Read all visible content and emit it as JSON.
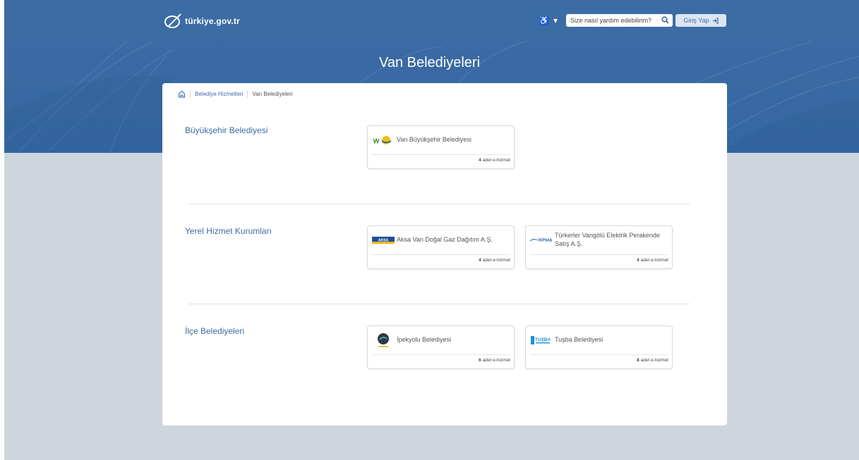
{
  "header": {
    "logo_text": "türkiye.gov.tr",
    "accessibility_label": "♿",
    "search_placeholder": "Size nasıl yardım edebilirim?",
    "login_label": "Giriş Yap"
  },
  "page": {
    "title": "Van Belediyeleri"
  },
  "breadcrumb": {
    "items": [
      "Belediye Hizmetleri",
      "Van Belediyeleri"
    ]
  },
  "sections": [
    {
      "title": "Büyükşehir Belediyesi",
      "tiles": [
        {
          "name": "Van Büyükşehir Belediyesi",
          "count": "4",
          "unit": "adet e-hizmet"
        }
      ]
    },
    {
      "title": "Yerel Hizmet Kurumları",
      "tiles": [
        {
          "name": "Aksa Van Doğal Gaz Dağıtım A.Ş.",
          "count": "4",
          "unit": "adet e-hizmet"
        },
        {
          "name": "Türkerler Vangölü Elektrik Perakende Satış A.Ş.",
          "count": "4",
          "unit": "adet e-hizmet"
        }
      ]
    },
    {
      "title": "İlçe Belediyeleri",
      "tiles": [
        {
          "name": "İpekyolu Belediyesi",
          "count": "6",
          "unit": "adet e-hizmet"
        },
        {
          "name": "Tuşba Belediyesi",
          "count": "8",
          "unit": "adet e-hizmet"
        }
      ]
    }
  ],
  "logos": {
    "aksa": "AKSA",
    "vepsas": "VEPSAŞ",
    "tusba": "TUŞBA"
  },
  "colors": {
    "brand_blue": "#3c6ca4",
    "page_bg": "#cfd5dd"
  }
}
